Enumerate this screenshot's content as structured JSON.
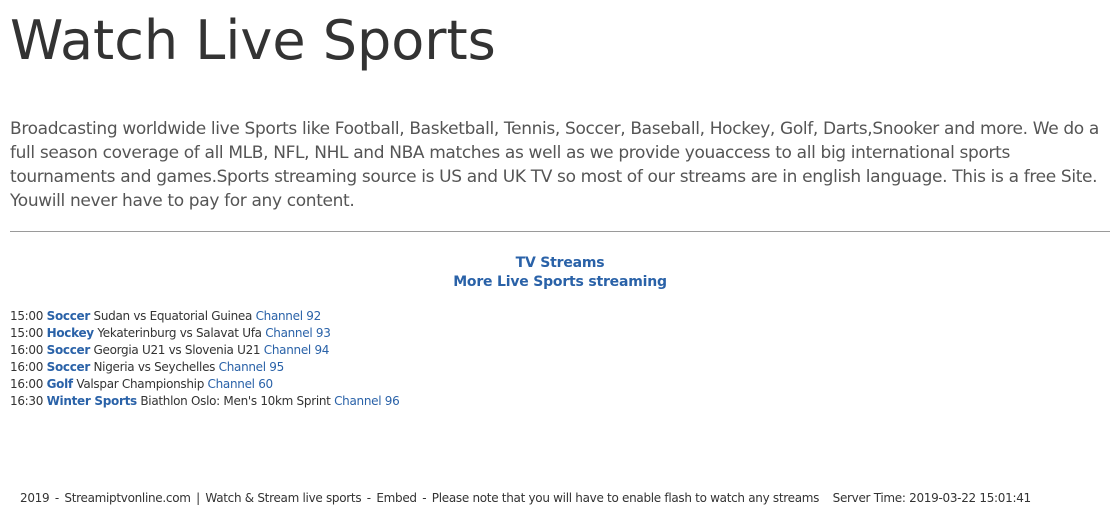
{
  "header": {
    "title": "Watch Live Sports"
  },
  "intro": {
    "text": "Broadcasting worldwide live Sports like Football, Basketball, Tennis, Soccer, Baseball, Hockey, Golf, Darts,Snooker and more. We do a full season coverage of all MLB, NFL, NHL and NBA matches as well as we provide youaccess to all big international sports tournaments and games.Sports streaming source is US and UK TV so most of our streams are in english language. This is a free Site. Youwill never have to pay for any content."
  },
  "nav": {
    "tv_streams": "TV Streams",
    "more_streaming": "More Live Sports streaming"
  },
  "schedule": [
    {
      "time": "15:00",
      "sport": "Soccer",
      "event": "Sudan vs Equatorial Guinea",
      "channel": "Channel 92"
    },
    {
      "time": "15:00",
      "sport": "Hockey",
      "event": "Yekaterinburg vs Salavat Ufa",
      "channel": "Channel 93"
    },
    {
      "time": "16:00",
      "sport": "Soccer",
      "event": "Georgia U21 vs Slovenia U21",
      "channel": "Channel 94"
    },
    {
      "time": "16:00",
      "sport": "Soccer",
      "event": "Nigeria vs Seychelles",
      "channel": "Channel 95"
    },
    {
      "time": "16:00",
      "sport": "Golf",
      "event": "Valspar Championship",
      "channel": "Channel 60"
    },
    {
      "time": "16:30",
      "sport": "Winter Sports",
      "event": "Biathlon Oslo: Men's 10km Sprint",
      "channel": "Channel 96"
    }
  ],
  "footer": {
    "year": "2019",
    "site": "Streamiptvonline.com",
    "tagline": "Watch & Stream live sports",
    "embed": "Embed",
    "note": "Please note that you will have to enable flash to watch any streams",
    "server_time_label": "Server Time:",
    "server_time_value": "2019-03-22 15:01:41"
  },
  "colors": {
    "link": "#2a62a8",
    "text": "#333333",
    "intro_text": "#555555",
    "divider": "#9a9a9a"
  }
}
